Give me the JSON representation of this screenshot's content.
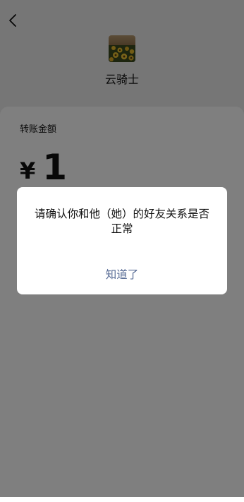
{
  "recipient": {
    "name": "云骑士",
    "avatar_icon": "sunflower-field-avatar"
  },
  "transfer": {
    "amount_label": "转账金额",
    "currency_symbol": "¥",
    "amount": "1"
  },
  "dialog": {
    "message": "请确认你和他（她）的好友关系是否正常",
    "confirm_label": "知道了"
  },
  "colors": {
    "background": "#ededed",
    "card": "#ffffff",
    "overlay": "rgba(0,0,0,0.5)",
    "link": "#576b95"
  }
}
